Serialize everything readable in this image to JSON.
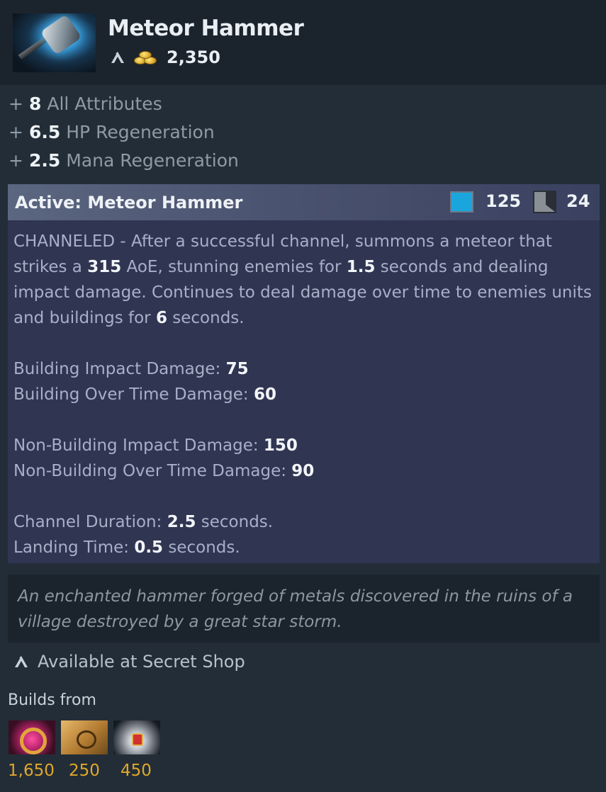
{
  "item": {
    "name": "Meteor Hammer",
    "cost": "2,350",
    "icon": "meteor-hammer-icon"
  },
  "attributes": [
    {
      "value": "8",
      "label": "All Attributes"
    },
    {
      "value": "6.5",
      "label": "HP Regeneration"
    },
    {
      "value": "2.5",
      "label": "Mana Regeneration"
    }
  ],
  "active": {
    "title": "Active: Meteor Hammer",
    "mana_cost": "125",
    "cooldown": "24",
    "desc": {
      "p1": "CHANNELED - After a successful channel, summons a meteor that strikes a ",
      "aoe": "315",
      "p2": " AoE, stunning enemies for ",
      "stun": "1.5",
      "p3": " seconds and dealing impact damage. Continues to deal damage over time to enemies units and buildings for ",
      "dot": "6",
      "p4": " seconds."
    },
    "stats": {
      "building_impact_label": "Building Impact Damage: ",
      "building_impact_value": "75",
      "building_overtime_label": "Building Over Time Damage: ",
      "building_overtime_value": "60",
      "nonbuilding_impact_label": "Non-Building Impact Damage: ",
      "nonbuilding_impact_value": "150",
      "nonbuilding_overtime_label": "Non-Building Over Time Damage: ",
      "nonbuilding_overtime_value": "90",
      "channel_label": "Channel Duration: ",
      "channel_value": "2.5",
      "channel_suffix": " seconds.",
      "landing_label": "Landing Time: ",
      "landing_value": "0.5",
      "landing_suffix": " seconds."
    }
  },
  "lore": "An enchanted hammer forged of metals discovered in the ruins of a village destroyed by a great star storm.",
  "availability": "Available at Secret Shop",
  "builds": {
    "label": "Builds from",
    "components": [
      {
        "icon": "ring-of-regen-icon",
        "price": "1,650"
      },
      {
        "icon": "recipe-scroll-icon",
        "price": "250"
      },
      {
        "icon": "crown-icon",
        "price": "450"
      }
    ]
  },
  "colors": {
    "background": "#232d37",
    "header": "#1b242d",
    "active_panel": "#303552",
    "mana": "#1aa6dd",
    "gold": "#e0a82a"
  }
}
